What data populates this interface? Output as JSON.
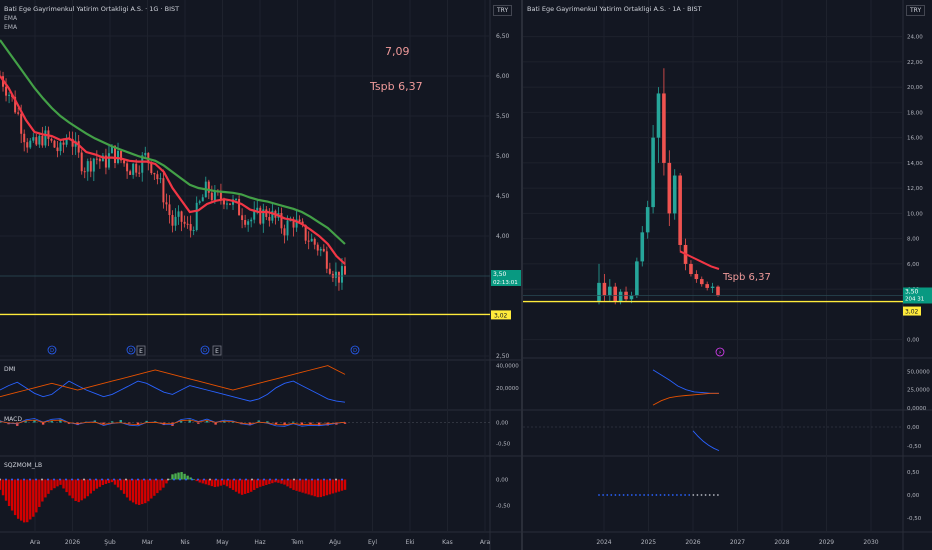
{
  "left": {
    "title": "Bati Ege Gayrimenkul Yatirim Ortakligi A.S. · 1G · BIST",
    "legend": [
      "EMA",
      "EMA"
    ],
    "currency": "TRY",
    "annotations": [
      "7,09",
      "Tspb 6,37"
    ],
    "price_label": "3,50",
    "countdown": "02:13:01",
    "level_label": "3,02",
    "event_markers": [
      "D",
      "D",
      "E",
      "D",
      "E",
      "D"
    ],
    "indicators": [
      "DMI",
      "MACD",
      "SQZMOM_LB"
    ]
  },
  "right": {
    "title": "Bati Ege Gayrimenkul Yatirim Ortakligi A.S. · 1A · BIST",
    "currency": "TRY",
    "annotation": "Tspb 6,37",
    "price_label": "3,50",
    "countdown": "204 31",
    "level_label": "3,02",
    "event_marker": "⚡"
  },
  "colors": {
    "background": "#131722",
    "grid": "#1e222d",
    "up": "#26a69a",
    "down": "#ef5350",
    "ema_fast": "#f23645",
    "ema_slow": "#43a047",
    "level": "#ffeb3b",
    "dmi_plus": "#2962ff",
    "dmi_minus": "#e65100",
    "sqz_neg": "#d50000",
    "sqz_pos": "#4caf50"
  },
  "chart_data": [
    {
      "type": "candlestick",
      "timeframe": "1G",
      "x_ticks": [
        "Ara",
        "2026",
        "Şub",
        "Mar",
        "Nis",
        "May",
        "Haz",
        "Tem",
        "Ağu",
        "Eyl",
        "Eki",
        "Kas",
        "Ara"
      ],
      "y_ticks": [
        "6,50",
        "6,00",
        "5,50",
        "5,00",
        "4,50",
        "4,00",
        "3,50",
        "2,50"
      ],
      "ylim": [
        2.5,
        6.6
      ],
      "close_path": [
        6.0,
        5.8,
        5.55,
        5.2,
        5.1,
        5.25,
        5.15,
        5.05,
        5.3,
        5.0,
        4.85,
        5.0,
        4.9,
        5.05,
        4.95,
        4.85,
        4.9,
        5.0,
        4.8,
        4.5,
        4.15,
        4.2,
        4.05,
        4.35,
        4.6,
        4.45,
        4.5,
        4.4,
        4.3,
        4.2,
        4.25,
        4.3,
        4.2,
        4.1,
        4.2,
        4.05,
        3.95,
        3.85,
        3.7,
        3.5,
        3.5
      ],
      "ema_fast": [
        6.0,
        5.85,
        5.65,
        5.45,
        5.3,
        5.27,
        5.25,
        5.2,
        5.22,
        5.15,
        5.05,
        5.02,
        4.98,
        4.98,
        4.97,
        4.94,
        4.93,
        4.93,
        4.9,
        4.8,
        4.6,
        4.45,
        4.3,
        4.32,
        4.4,
        4.44,
        4.46,
        4.44,
        4.4,
        4.33,
        4.3,
        4.3,
        4.27,
        4.22,
        4.2,
        4.15,
        4.08,
        4.0,
        3.9,
        3.75,
        3.65
      ],
      "ema_slow": [
        6.45,
        6.3,
        6.15,
        6.0,
        5.85,
        5.72,
        5.6,
        5.5,
        5.42,
        5.35,
        5.28,
        5.22,
        5.17,
        5.12,
        5.08,
        5.04,
        5.0,
        4.97,
        4.94,
        4.88,
        4.8,
        4.72,
        4.64,
        4.6,
        4.58,
        4.56,
        4.55,
        4.54,
        4.52,
        4.48,
        4.45,
        4.43,
        4.4,
        4.37,
        4.34,
        4.3,
        4.24,
        4.17,
        4.1,
        4.0,
        3.9
      ],
      "level": 3.02,
      "annotations": [
        {
          "text": "7,09"
        },
        {
          "text": "Tspb 6,37"
        }
      ],
      "last_price": 3.5
    },
    {
      "type": "line",
      "name": "DMI",
      "y_ticks": [
        "40,0000",
        "20,0000"
      ],
      "ylim": [
        0,
        45
      ],
      "plus_di": [
        18,
        22,
        25,
        20,
        15,
        12,
        14,
        20,
        26,
        22,
        18,
        15,
        12,
        14,
        18,
        22,
        26,
        24,
        20,
        16,
        14,
        18,
        22,
        20,
        18,
        16,
        14,
        12,
        10,
        8,
        10,
        14,
        20,
        24,
        26,
        22,
        18,
        14,
        10,
        8,
        7
      ],
      "minus_di": [
        12,
        14,
        16,
        18,
        20,
        22,
        24,
        22,
        20,
        18,
        20,
        22,
        24,
        26,
        28,
        30,
        32,
        34,
        36,
        34,
        32,
        30,
        28,
        26,
        24,
        22,
        20,
        18,
        20,
        22,
        24,
        26,
        28,
        30,
        32,
        34,
        36,
        38,
        40,
        36,
        32
      ]
    },
    {
      "type": "bar",
      "name": "MACD",
      "y_ticks": [
        "0,00",
        "-0,50"
      ],
      "ylim": [
        -0.8,
        0.3
      ],
      "histogram": [
        0.05,
        -0.04,
        -0.08,
        0.03,
        0.06,
        -0.05,
        0.04,
        0.07,
        -0.03,
        -0.06,
        0.02,
        0.05,
        -0.04,
        0.03,
        0.06,
        -0.02,
        -0.05,
        0.04,
        0.03,
        -0.06,
        -0.08,
        0.05,
        0.07,
        -0.03,
        0.04,
        -0.05,
        0.03,
        0.02,
        -0.04,
        -0.06,
        0.05,
        0.03,
        -0.04,
        -0.05,
        0.02,
        -0.06,
        -0.05,
        -0.08,
        -0.07,
        -0.05,
        -0.03
      ]
    },
    {
      "type": "bar",
      "name": "SQZMOM_LB",
      "y_ticks": [
        "0,00",
        "-0,50"
      ],
      "ylim": [
        -0.9,
        0.3
      ],
      "values": [
        -0.2,
        -0.5,
        -0.75,
        -0.85,
        -0.7,
        -0.4,
        -0.2,
        -0.1,
        -0.3,
        -0.45,
        -0.35,
        -0.2,
        -0.1,
        -0.05,
        -0.2,
        -0.4,
        -0.5,
        -0.45,
        -0.3,
        -0.15,
        0.1,
        0.15,
        0.05,
        -0.05,
        -0.1,
        -0.15,
        -0.1,
        -0.2,
        -0.3,
        -0.25,
        -0.15,
        -0.1,
        -0.05,
        -0.1,
        -0.2,
        -0.25,
        -0.3,
        -0.35,
        -0.3,
        -0.25,
        -0.2
      ]
    },
    {
      "type": "candlestick",
      "timeframe": "1A",
      "x_ticks": [
        "2024",
        "2025",
        "2026",
        "2027",
        "2028",
        "2029",
        "2030"
      ],
      "y_ticks": [
        "24,00",
        "22,00",
        "20,00",
        "18,00",
        "16,00",
        "14,00",
        "12,00",
        "10,00",
        "8,00",
        "6,00",
        "4,00",
        "0,00"
      ],
      "ylim": [
        -0.5,
        25
      ],
      "candles": [
        [
          3.0,
          6.0,
          2.8,
          4.5
        ],
        [
          4.5,
          5.2,
          3.0,
          3.5
        ],
        [
          3.5,
          4.8,
          3.0,
          4.2
        ],
        [
          4.2,
          4.5,
          2.8,
          3.0
        ],
        [
          3.0,
          4.0,
          2.8,
          3.8
        ],
        [
          3.8,
          4.2,
          3.0,
          3.2
        ],
        [
          3.2,
          3.8,
          2.9,
          3.5
        ],
        [
          3.5,
          6.5,
          3.3,
          6.2
        ],
        [
          6.2,
          9.0,
          5.8,
          8.5
        ],
        [
          8.5,
          11.0,
          8.0,
          10.5
        ],
        [
          10.5,
          17.0,
          10.0,
          16.0
        ],
        [
          16.0,
          20.0,
          14.0,
          19.5
        ],
        [
          19.5,
          21.5,
          13.0,
          14.0
        ],
        [
          14.0,
          15.0,
          9.0,
          10.0
        ],
        [
          10.0,
          13.5,
          9.5,
          13.0
        ],
        [
          13.0,
          13.2,
          7.0,
          7.5
        ],
        [
          7.5,
          8.0,
          5.5,
          6.0
        ],
        [
          6.0,
          6.3,
          5.0,
          5.2
        ],
        [
          5.2,
          5.5,
          4.5,
          4.8
        ],
        [
          4.8,
          5.0,
          4.2,
          4.4
        ],
        [
          4.4,
          4.6,
          3.9,
          4.1
        ],
        [
          4.1,
          4.5,
          3.7,
          4.2
        ],
        [
          4.2,
          4.3,
          3.4,
          3.5
        ]
      ],
      "ema": [
        7.0,
        6.7,
        6.4,
        6.1,
        5.8,
        5.6
      ],
      "plus_di_series": [
        52,
        45,
        38,
        30,
        25,
        22,
        21,
        20,
        20
      ],
      "minus_di_series": [
        4,
        10,
        14,
        16,
        17,
        18,
        19,
        20,
        20
      ],
      "macd_series": [
        -0.1,
        -0.25,
        -0.38,
        -0.48,
        -0.56,
        -0.62
      ],
      "sqz_dots": 30,
      "level": 3.02,
      "last_price": 3.5,
      "sub_y_ticks": {
        "dmi": [
          "50,0000",
          "25,0000",
          "0,0000"
        ],
        "macd": [
          "0,00",
          "-0,50"
        ],
        "sqz": [
          "0,50",
          "0,00",
          "-0,50"
        ]
      }
    }
  ]
}
